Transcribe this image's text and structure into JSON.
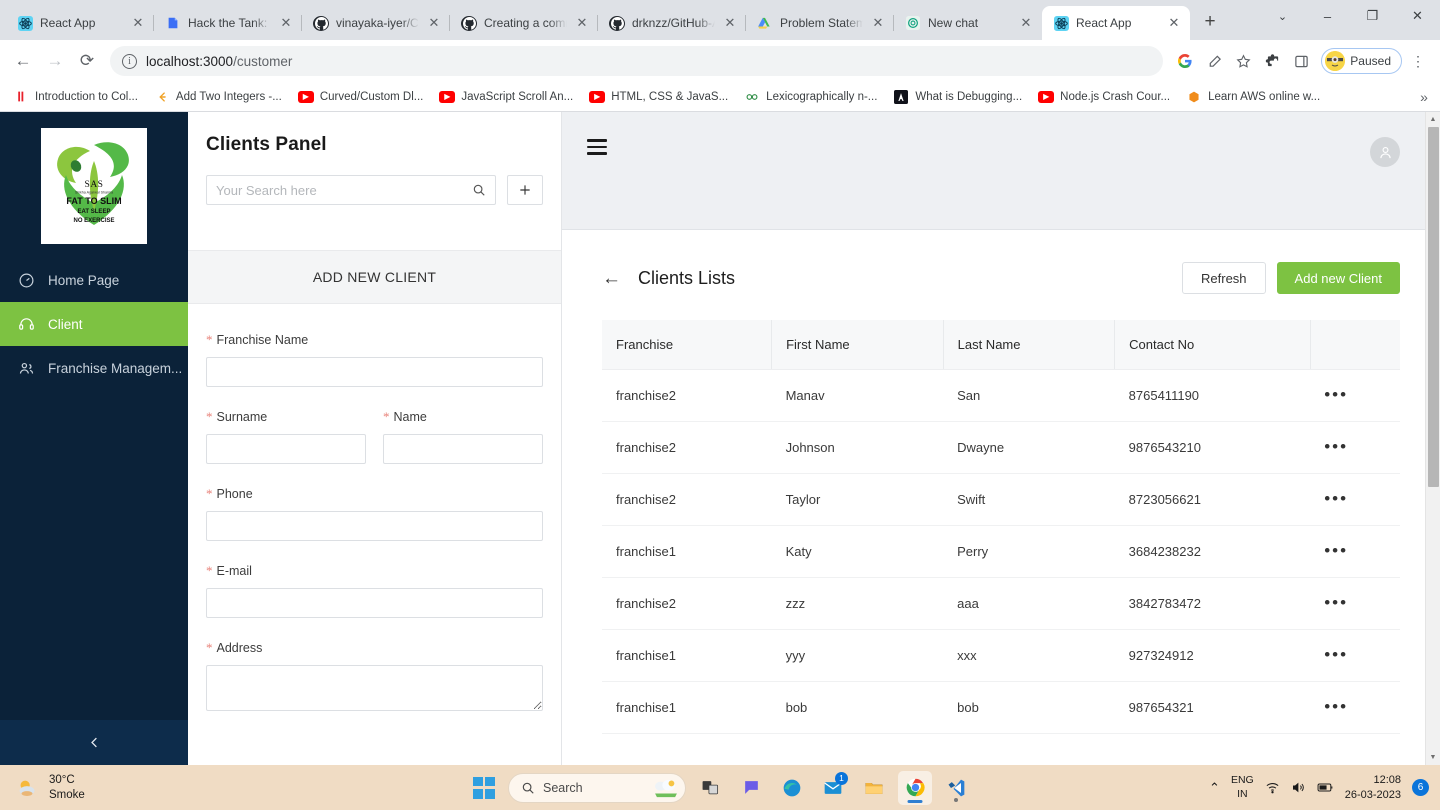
{
  "browser": {
    "tabs": [
      {
        "title": "React App",
        "favicon": "react-icon",
        "active": false
      },
      {
        "title": "Hack the Tank: Da",
        "favicon": "blue-doc-icon",
        "active": false
      },
      {
        "title": "vinayaka-iyer/Cip",
        "favicon": "github-icon",
        "active": false
      },
      {
        "title": "Creating a comm",
        "favicon": "github-icon",
        "active": false
      },
      {
        "title": "drknzz/GitHub-A",
        "favicon": "github-icon",
        "active": false
      },
      {
        "title": "Problem Stateme",
        "favicon": "google-drive-icon",
        "active": false
      },
      {
        "title": "New chat",
        "favicon": "openai-icon",
        "active": false
      },
      {
        "title": "React App",
        "favicon": "react-icon",
        "active": true
      }
    ],
    "new_tab_label": "+",
    "tab_close_label": "✕",
    "window_controls": {
      "list": "⌄",
      "minimize": "–",
      "maximize": "❐",
      "close": "✕"
    },
    "nav": {
      "back": "←",
      "forward": "→",
      "reload": "⟳"
    },
    "address": {
      "scheme_icon": "info-circle-icon",
      "host": "localhost:3000",
      "path": "/customer"
    },
    "toolbar_icons": [
      "google-g-icon",
      "share-icon",
      "star-icon",
      "extensions-icon",
      "side-panel-icon"
    ],
    "profile": {
      "label": "Paused",
      "avatar": "minion-avatar"
    },
    "menu_label": "⋮",
    "bookmarks": [
      {
        "label": "Introduction to Col...",
        "favicon": "red-bars-icon"
      },
      {
        "label": "Add Two Integers -...",
        "favicon": "leetcode-icon"
      },
      {
        "label": "Curved/Custom Dl...",
        "favicon": "youtube-icon"
      },
      {
        "label": "JavaScript Scroll An...",
        "favicon": "youtube-icon"
      },
      {
        "label": "HTML, CSS & JavaS...",
        "favicon": "youtube-icon"
      },
      {
        "label": "Lexicographically n-...",
        "favicon": "geeksforgeeks-icon"
      },
      {
        "label": "What is Debugging...",
        "favicon": "black-a-icon"
      },
      {
        "label": "Node.js Crash Cour...",
        "favicon": "youtube-icon"
      },
      {
        "label": "Learn AWS online w...",
        "favicon": "aws-icon"
      }
    ],
    "bookmarks_overflow": "»"
  },
  "app": {
    "sidebar": {
      "logo_text": {
        "brand": "SAS",
        "tagline": "Shikha Agarwal Sharma",
        "line1": "FAT TO SLIM",
        "line2": "EAT SLEEP",
        "line3": "NO EXERCISE"
      },
      "items": [
        {
          "label": "Home Page",
          "icon": "dashboard-icon",
          "active": false
        },
        {
          "label": "Client",
          "icon": "headset-icon",
          "active": true
        },
        {
          "label": "Franchise Managem...",
          "icon": "people-icon",
          "active": false
        }
      ],
      "collapse_icon": "chevron-left-icon",
      "bg_color": "#0b2239",
      "active_color": "#7dc242"
    },
    "panel": {
      "title": "Clients Panel",
      "search_placeholder": "Your Search here",
      "search_value": "",
      "search_icon": "search-icon",
      "add_icon": "plus-icon",
      "add_new_client_header": "ADD NEW CLIENT",
      "fields": [
        {
          "label": "Franchise Name",
          "required": true,
          "value": "",
          "type": "text",
          "name": "franchise-name"
        },
        {
          "label": "Surname",
          "required": true,
          "value": "",
          "type": "text",
          "name": "surname"
        },
        {
          "label": "Name",
          "required": true,
          "value": "",
          "type": "text",
          "name": "name"
        },
        {
          "label": "Phone",
          "required": true,
          "value": "",
          "type": "text",
          "name": "phone"
        },
        {
          "label": "E-mail",
          "required": true,
          "value": "",
          "type": "text",
          "name": "email"
        },
        {
          "label": "Address",
          "required": true,
          "value": "",
          "type": "textarea",
          "name": "address"
        }
      ],
      "required_marker": "*"
    },
    "topbar": {
      "menu_icon": "hamburger-icon",
      "avatar_icon": "user-avatar-icon"
    },
    "list": {
      "back_icon": "←",
      "title": "Clients Lists",
      "refresh_label": "Refresh",
      "add_label": "Add new Client",
      "accent_color": "#7dc242",
      "columns": [
        "Franchise",
        "First Name",
        "Last Name",
        "Contact No",
        ""
      ],
      "row_action_icon": "•••",
      "rows": [
        {
          "franchise": "franchise2",
          "first_name": "Manav",
          "last_name": "San",
          "contact": "8765411190"
        },
        {
          "franchise": "franchise2",
          "first_name": "Johnson",
          "last_name": "Dwayne",
          "contact": "9876543210"
        },
        {
          "franchise": "franchise2",
          "first_name": "Taylor",
          "last_name": "Swift",
          "contact": "8723056621"
        },
        {
          "franchise": "franchise1",
          "first_name": "Katy",
          "last_name": "Perry",
          "contact": "3684238232"
        },
        {
          "franchise": "franchise2",
          "first_name": "zzz",
          "last_name": "aaa",
          "contact": "3842783472"
        },
        {
          "franchise": "franchise1",
          "first_name": "yyy",
          "last_name": "xxx",
          "contact": "927324912"
        },
        {
          "franchise": "franchise1",
          "first_name": "bob",
          "last_name": "bob",
          "contact": "987654321"
        }
      ]
    }
  },
  "taskbar": {
    "weather": {
      "temp": "30°C",
      "condition": "Smoke",
      "icon": "sun-cloud-icon"
    },
    "start_icon": "windows-logo",
    "search": {
      "label": "Search",
      "icon": "search-icon"
    },
    "apps": [
      {
        "name": "task-view-icon",
        "open": false
      },
      {
        "name": "chat-icon",
        "open": false
      },
      {
        "name": "edge-icon",
        "open": false
      },
      {
        "name": "mail-icon",
        "open": false,
        "badge": "1"
      },
      {
        "name": "file-explorer-icon",
        "open": false
      },
      {
        "name": "chrome-icon",
        "open": true
      },
      {
        "name": "vscode-icon",
        "open": false
      }
    ],
    "tray": {
      "overflow": "⌃",
      "lang_line1": "ENG",
      "lang_line2": "IN",
      "wifi": "wifi-icon",
      "volume": "volume-icon",
      "battery": "battery-icon"
    },
    "clock": {
      "time": "12:08",
      "date": "26-03-2023"
    },
    "notification_count": "6"
  }
}
